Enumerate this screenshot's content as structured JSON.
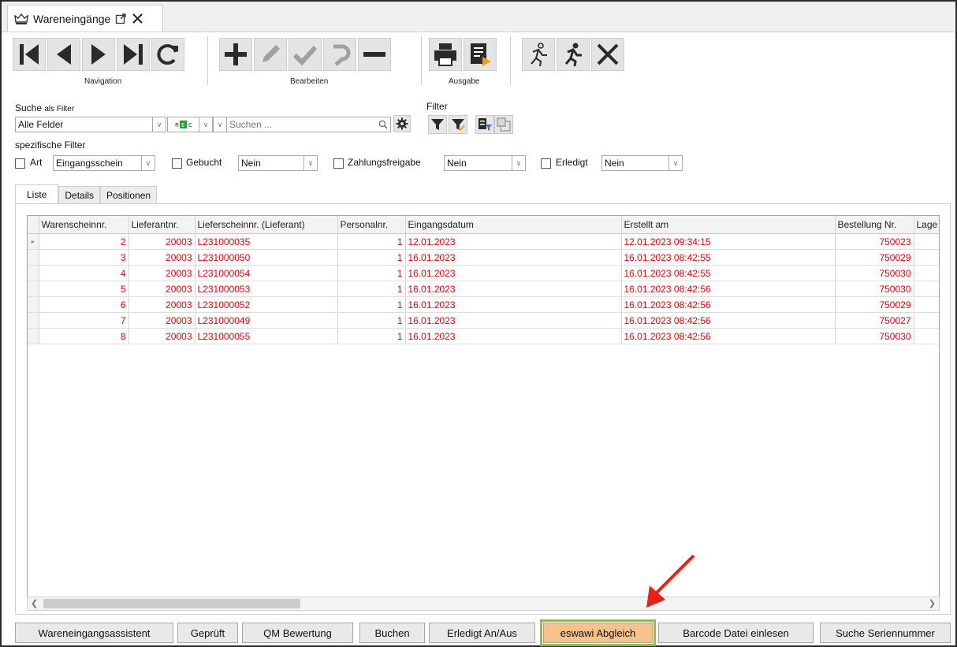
{
  "window": {
    "tab_title": "Wareneingänge"
  },
  "toolbar": {
    "groups": [
      {
        "label": "Navigation"
      },
      {
        "label": "Bearbeiten"
      },
      {
        "label": "Ausgabe"
      }
    ]
  },
  "search": {
    "title": "Suche",
    "title_suffix": "als Filter",
    "field_value": "Alle Felder",
    "placeholder": "Suchen ..."
  },
  "filter": {
    "title": "Filter"
  },
  "specific_filters": {
    "title": "spezifische Filter",
    "art": {
      "label": "Art",
      "value": "Eingangsschein"
    },
    "gebucht": {
      "label": "Gebucht",
      "value": "Nein"
    },
    "zahlungsfreigabe": {
      "label": "Zahlungsfreigabe",
      "value": "Nein"
    },
    "erledigt": {
      "label": "Erledigt",
      "value": "Nein"
    }
  },
  "tabs": [
    {
      "label": "Liste",
      "active": true
    },
    {
      "label": "Details",
      "active": false
    },
    {
      "label": "Positionen",
      "active": false
    }
  ],
  "grid": {
    "columns": [
      "Warenscheinnr.",
      "Lieferantnr.",
      "Lieferscheinnr. (Lieferant)",
      "Personalnr.",
      "Eingangsdatum",
      "Erstellt am",
      "Bestellung Nr.",
      "Lage"
    ],
    "rows": [
      [
        "2",
        "20003",
        "L231000035",
        "1",
        "12.01.2023",
        "12.01.2023 09:34:15",
        "750023"
      ],
      [
        "3",
        "20003",
        "L231000050",
        "1",
        "16.01.2023",
        "16.01.2023 08:42:55",
        "750029"
      ],
      [
        "4",
        "20003",
        "L231000054",
        "1",
        "16.01.2023",
        "16.01.2023 08:42:55",
        "750030"
      ],
      [
        "5",
        "20003",
        "L231000053",
        "1",
        "16.01.2023",
        "16.01.2023 08:42:56",
        "750030"
      ],
      [
        "6",
        "20003",
        "L231000052",
        "1",
        "16.01.2023",
        "16.01.2023 08:42:56",
        "750029"
      ],
      [
        "7",
        "20003",
        "L231000049",
        "1",
        "16.01.2023",
        "16.01.2023 08:42:56",
        "750027"
      ],
      [
        "8",
        "20003",
        "L231000055",
        "1",
        "16.01.2023",
        "16.01.2023 08:42:56",
        "750030"
      ]
    ],
    "row_text_color": "#e8000b"
  },
  "bottom_buttons": [
    {
      "label": "Wareneingangsassistent"
    },
    {
      "label": "Geprüft"
    },
    {
      "label": "QM Bewertung"
    },
    {
      "label": "Buchen"
    },
    {
      "label": "Erledigt An/Aus"
    },
    {
      "label": "eswawi Abgleich",
      "highlighted": true
    },
    {
      "label": "Barcode Datei einlesen"
    },
    {
      "label": "Suche Seriennummer"
    }
  ],
  "colors": {
    "highlight_fill": "#f7c28a",
    "highlight_outline": "#8fc13e",
    "annotation_arrow": "#e8201a",
    "icon_gray": "#2a2a2a"
  }
}
